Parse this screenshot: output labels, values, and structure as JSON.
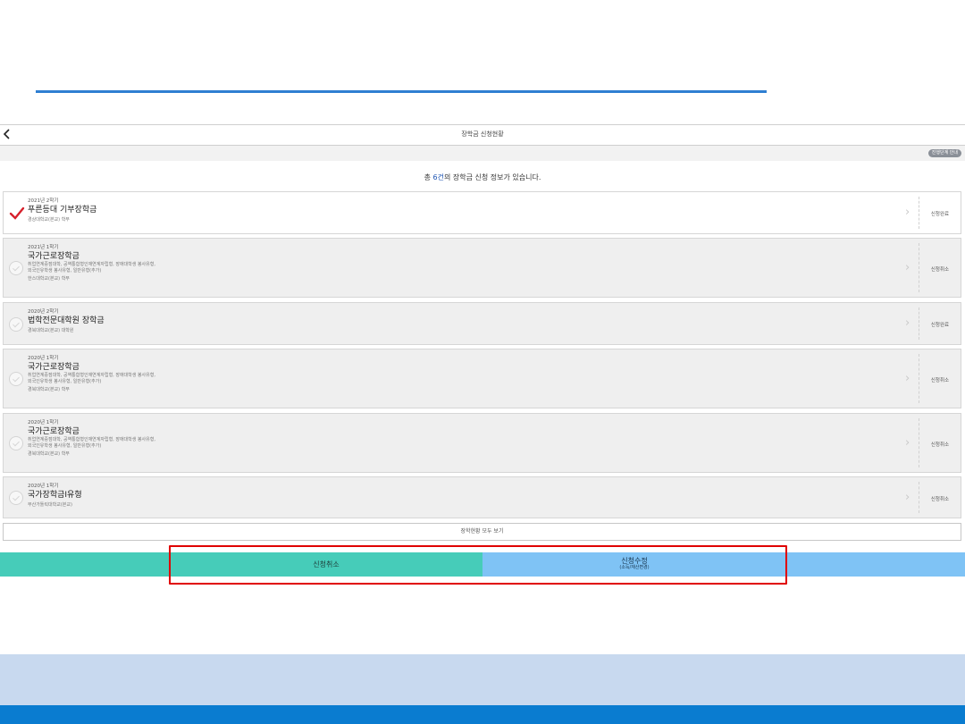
{
  "header": {
    "title": "장학금 신청현황",
    "back_icon": "chevron-left-icon"
  },
  "help_badge": "진행단계 안내",
  "summary": {
    "prefix": "총 ",
    "count": "6건",
    "suffix": "의 장학금 신청 정보가 있습니다."
  },
  "cards": [
    {
      "term": "2021년 2학기",
      "name": "푸른등대 기부장학금",
      "details": [],
      "school": "경상대학교(본교) 학부",
      "status": "신청완료",
      "checked": true
    },
    {
      "term": "2021년 1학기",
      "name": "국가근로장학금",
      "details": [
        "취업연계중점대학, 공역통합형인재연계자립형, 장애대학생 봉사유형,",
        "외국인유학생 봉사유형, 일반유형(추가)"
      ],
      "school": "한스대학교(본교) 학부",
      "status": "신청취소",
      "checked": false
    },
    {
      "term": "2020년 2학기",
      "name": "법학전문대학원 장학금",
      "details": [],
      "school": "경북대학교(본교) 대학원",
      "status": "신청완료",
      "checked": false
    },
    {
      "term": "2020년 1학기",
      "name": "국가근로장학금",
      "details": [
        "취업연계중점대학, 공역통합형인재연계자립형, 장애대학생 봉사유형,",
        "외국인유학생 봉사유형, 일반유형(추가)"
      ],
      "school": "경북대학교(본교) 학부",
      "status": "신청취소",
      "checked": false
    },
    {
      "term": "2020년 1학기",
      "name": "국가근로장학금",
      "details": [
        "취업연계중점대학, 공역통합형인재연계자립형, 장애대학생 봉사유형,",
        "외국인유학생 봉사유형, 일반유형(추가)"
      ],
      "school": "경북대학교(본교) 학부",
      "status": "신청취소",
      "checked": false
    },
    {
      "term": "2020년 1학기",
      "name": "국가장학금I유형",
      "details": [],
      "school": "부산가톨릭대학교(본교)",
      "status": "신청취소",
      "checked": false
    }
  ],
  "view_all": "장학현황 모두 보기",
  "buttons": {
    "cancel": "신청취소",
    "edit": "신청수정",
    "edit_sub": "(소득/재산변경)"
  },
  "colors": {
    "accent_blue": "#2f7fd2",
    "cancel_bar": "#46ccb9",
    "edit_bar": "#7fc3f5",
    "highlight": "#e00000",
    "footer_light": "#c8d9ef",
    "footer_dark": "#0a7cd0",
    "check_red": "#d7202b"
  }
}
